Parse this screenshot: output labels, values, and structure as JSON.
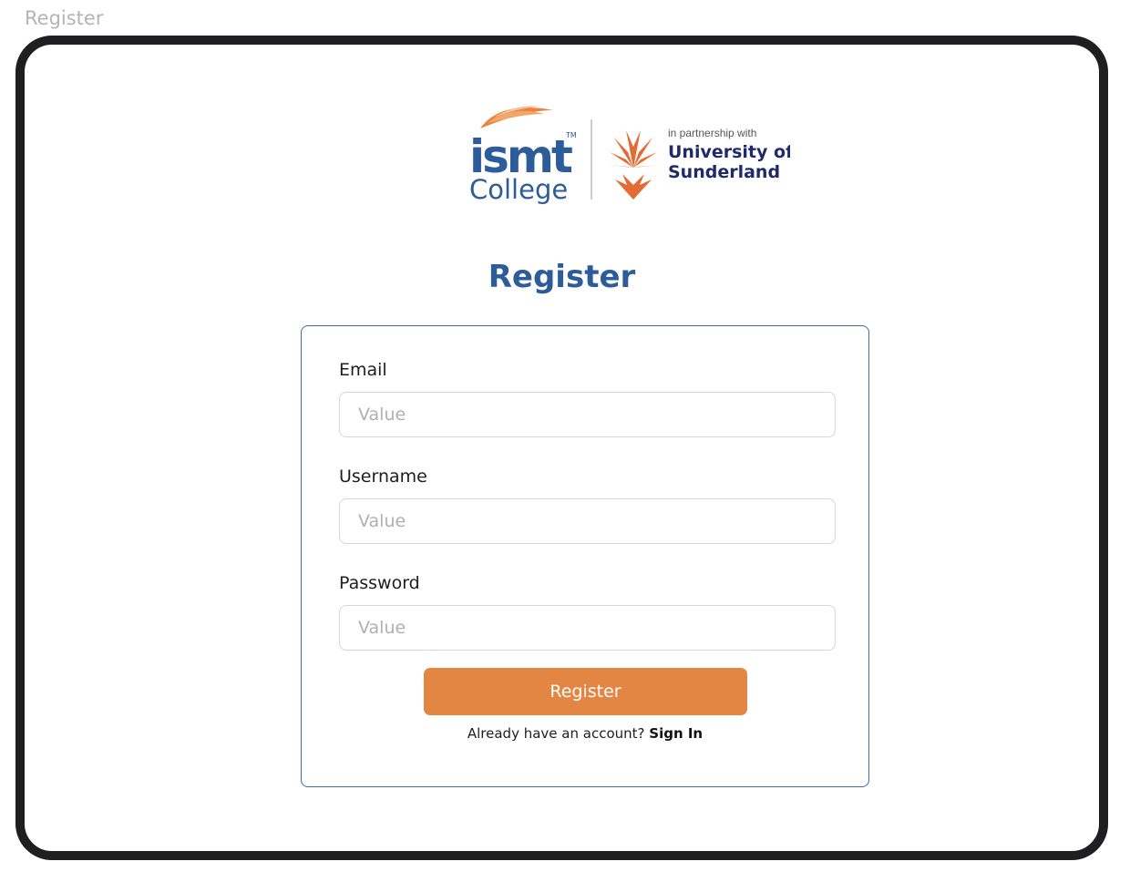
{
  "frame": {
    "label": "Register"
  },
  "logo": {
    "ismt_word": "ismt",
    "ismt_tm": "TM",
    "college": "College",
    "partnership": "in partnership with",
    "university_line1": "University of",
    "university_line2": "Sunderland"
  },
  "page": {
    "title": "Register"
  },
  "form": {
    "email_label": "Email",
    "email_placeholder": "Value",
    "username_label": "Username",
    "username_placeholder": "Value",
    "password_label": "Password",
    "password_placeholder": "Value",
    "register_button": "Register",
    "signin_prompt": "Already have an account?",
    "signin_link": "Sign In"
  },
  "colors": {
    "brand_blue": "#2d5c9b",
    "accent_orange": "#e38644",
    "frame_dark": "#1f1f22"
  }
}
